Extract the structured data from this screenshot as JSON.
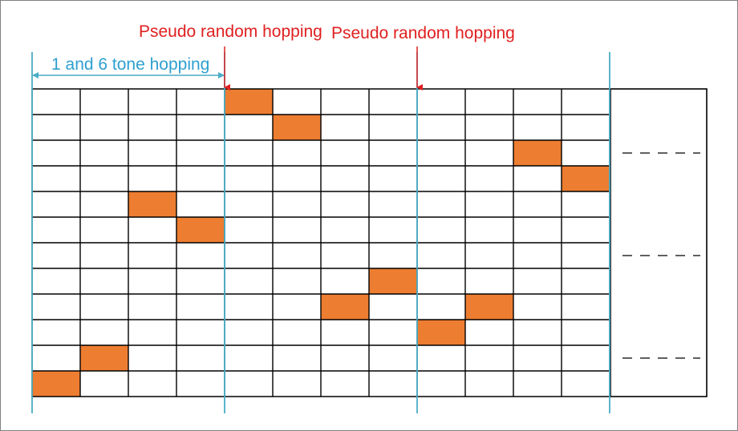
{
  "labels": {
    "hop_range": "1 and 6 tone hopping",
    "pseudo_random_1": "Pseudo random hopping",
    "pseudo_random_2": "Pseudo random hopping"
  },
  "grid": {
    "columns": 12,
    "rows": 12,
    "filled_cells": [
      [
        0,
        11
      ],
      [
        1,
        10
      ],
      [
        2,
        4
      ],
      [
        3,
        5
      ],
      [
        4,
        0
      ],
      [
        5,
        1
      ],
      [
        6,
        8
      ],
      [
        7,
        7
      ],
      [
        8,
        9
      ],
      [
        9,
        8
      ],
      [
        10,
        2
      ],
      [
        11,
        3
      ]
    ],
    "continuation_rows": [
      2,
      6,
      10
    ]
  },
  "colors": {
    "fill": "#ed7d31",
    "grid_line": "#000000",
    "boundary": "#4bacc6",
    "hop_label": "#2e9fd0",
    "pseudo_label": "#e02020",
    "frame": "#7f7f7f"
  }
}
